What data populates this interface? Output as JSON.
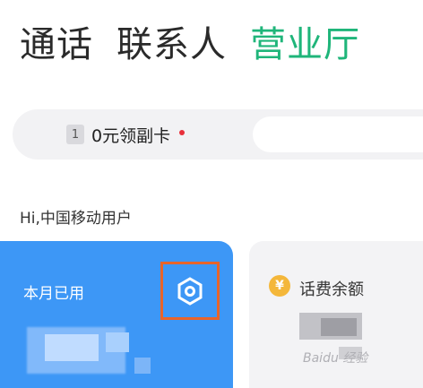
{
  "tabs": [
    {
      "label": "通话",
      "active": false
    },
    {
      "label": "联系人",
      "active": false
    },
    {
      "label": "营业厅",
      "active": true
    }
  ],
  "promo": {
    "sim_number": "1",
    "text": "0元领副卡",
    "dot_color": "#e8303a"
  },
  "greeting": "Hi,中国移动用户",
  "usage_card": {
    "title": "本月已用",
    "icon": "settings-hexagon-icon",
    "color": "#3d97f6"
  },
  "balance_card": {
    "icon_text": "¥",
    "title": "话费余额"
  },
  "watermark": "Baidu 经验",
  "colors": {
    "accent": "#1fb57a",
    "highlight_box": "#e8642a"
  }
}
